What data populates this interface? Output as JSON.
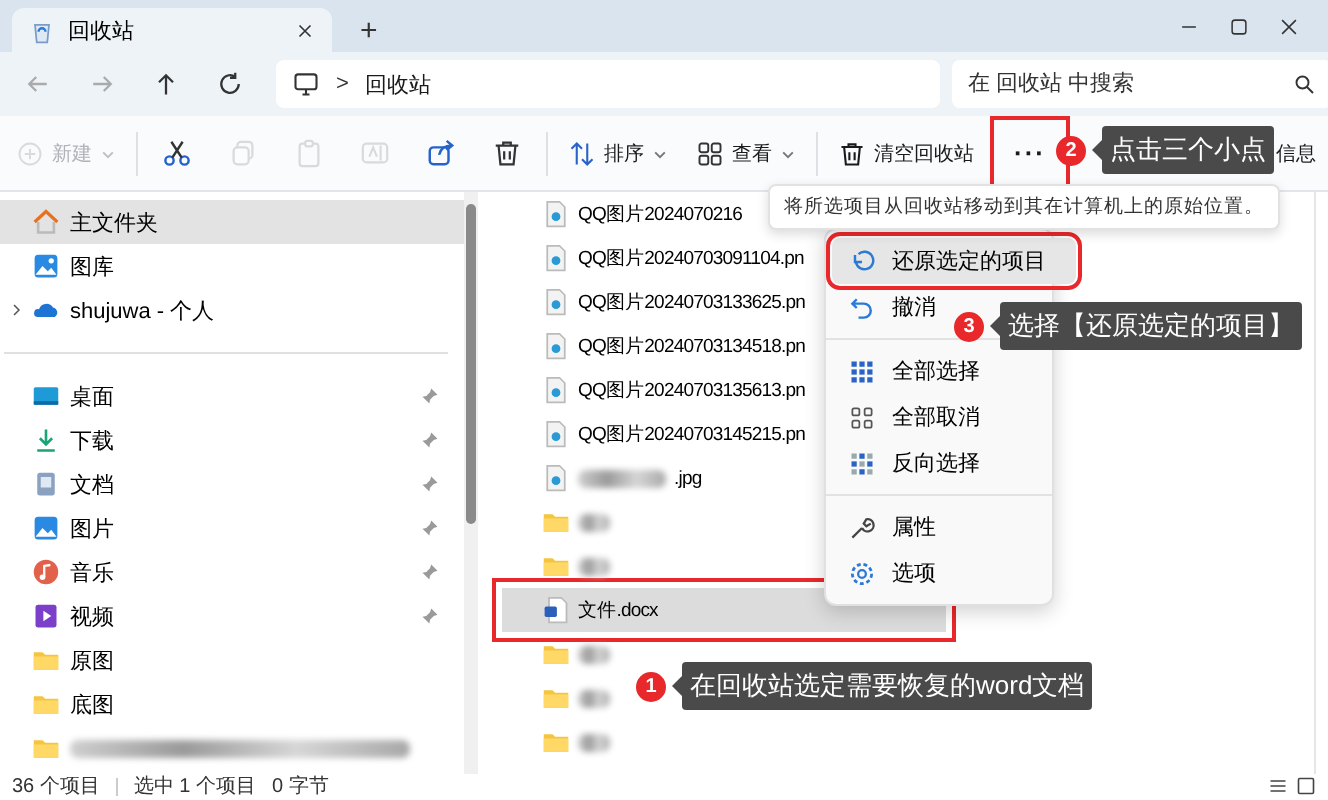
{
  "window": {
    "tab_title": "回收站",
    "new_tab": "+"
  },
  "nav": {
    "separator": ">",
    "location": "回收站",
    "search": {
      "placeholder": "在 回收站 中搜索"
    }
  },
  "toolbar": {
    "new_button": {
      "label": "新建",
      "disabled": true
    },
    "edit_actions": [
      {
        "disabled": false
      },
      {
        "disabled": true
      },
      {
        "disabled": true
      },
      {
        "disabled": true
      },
      {
        "disabled": false
      },
      {
        "disabled": false
      }
    ],
    "sort_button": {
      "label": "排序"
    },
    "view_button": {
      "label": "查看"
    },
    "empty_button": {
      "label": "清空回收站"
    },
    "more_button": {
      "label": "···",
      "annotated": true
    },
    "details_button": {
      "label": "信息"
    }
  },
  "sidebar": {
    "top": [
      {
        "label": "主文件夹",
        "selected": true,
        "expandable": false
      },
      {
        "label": "图库",
        "selected": false,
        "expandable": false
      },
      {
        "label": "shujuwa - 个人",
        "selected": false,
        "expandable": true
      }
    ],
    "pinned": [
      {
        "label": "桌面",
        "pinned": true
      },
      {
        "label": "下载",
        "pinned": true
      },
      {
        "label": "文档",
        "pinned": true
      },
      {
        "label": "图片",
        "pinned": true
      },
      {
        "label": "音乐",
        "pinned": true
      },
      {
        "label": "视频",
        "pinned": true
      },
      {
        "label": "原图",
        "pinned": false
      },
      {
        "label": "底图",
        "pinned": false
      }
    ]
  },
  "files": [
    {
      "kind": "image",
      "name": "QQ图片2024070216",
      "blurred": false,
      "selected": false,
      "annotated": false
    },
    {
      "kind": "image",
      "name": "QQ图片20240703091104.pn",
      "blurred": false,
      "selected": false,
      "annotated": false
    },
    {
      "kind": "image",
      "name": "QQ图片20240703133625.pn",
      "blurred": false,
      "selected": false,
      "annotated": false
    },
    {
      "kind": "image",
      "name": "QQ图片20240703134518.pn",
      "blurred": false,
      "selected": false,
      "annotated": false
    },
    {
      "kind": "image",
      "name": "QQ图片20240703135613.pn",
      "blurred": false,
      "selected": false,
      "annotated": false
    },
    {
      "kind": "image",
      "name": "QQ图片20240703145215.pn",
      "blurred": false,
      "selected": false,
      "annotated": false
    },
    {
      "kind": "image",
      "name": ".jpg",
      "blurred": true,
      "selected": false,
      "annotated": false
    },
    {
      "kind": "folder",
      "blurred": true,
      "selected": false,
      "annotated": false
    },
    {
      "kind": "folder",
      "blurred": true,
      "selected": false,
      "annotated": false
    },
    {
      "kind": "document",
      "name": "文件.docx",
      "blurred": false,
      "selected": true,
      "annotated": true
    },
    {
      "kind": "folder",
      "blurred": true,
      "selected": false,
      "annotated": false
    },
    {
      "kind": "folder",
      "blurred": true,
      "selected": false,
      "annotated": false
    },
    {
      "kind": "folder",
      "blurred": true,
      "selected": false,
      "annotated": false
    }
  ],
  "menu": {
    "tooltip": "将所选项目从回收站移动到其在计算机上的原始位置。",
    "groups": [
      [
        {
          "label": "还原选定的项目",
          "selected": true,
          "annotated": true
        },
        {
          "label": "撤消",
          "selected": false,
          "annotated": false
        }
      ],
      [
        {
          "label": "全部选择",
          "selected": false,
          "annotated": false
        },
        {
          "label": "全部取消",
          "selected": false,
          "annotated": false
        },
        {
          "label": "反向选择",
          "selected": false,
          "annotated": false
        }
      ],
      [
        {
          "label": "属性",
          "selected": false,
          "annotated": false
        },
        {
          "label": "选项",
          "selected": false,
          "annotated": false
        }
      ]
    ]
  },
  "callouts": [
    {
      "number": "1",
      "text": "在回收站选定需要恢复的word文档"
    },
    {
      "number": "2",
      "text": "点击三个小点"
    },
    {
      "number": "3",
      "text": "选择【还原选定的项目】"
    }
  ],
  "status_bar": [
    "36 个项目",
    "选中 1 个项目",
    "0 字节"
  ]
}
